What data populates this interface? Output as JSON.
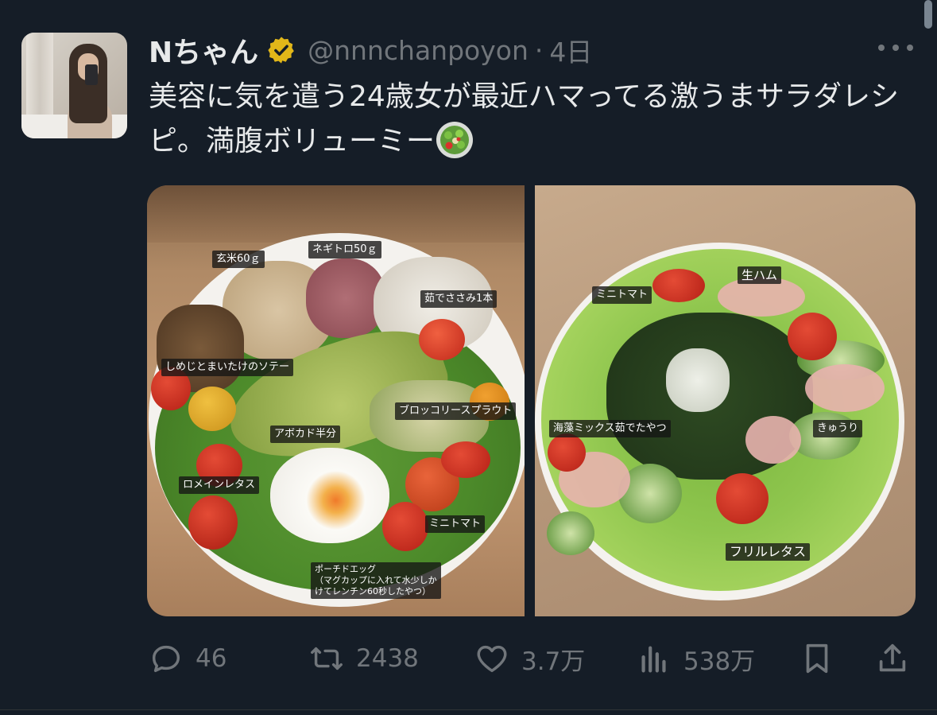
{
  "user": {
    "display_name": "Nちゃん",
    "handle": "@nnnchanpoyon",
    "separator": "·",
    "time": "4日",
    "verified": true
  },
  "tweet": {
    "text": "美容に気を遣う24歳女が最近ハマってる激うまサラダレシピ。満腹ボリューミー",
    "emoji": "salad-bowl-icon"
  },
  "media": {
    "left_labels": {
      "genmai": "玄米60ｇ",
      "negitoro": "ネギトロ50ｇ",
      "sasami": "茹でささみ1本",
      "shimeji": "しめじとまいたけのソテー",
      "broccoli": "ブロッコリースプラウト",
      "avocado": "アボカド半分",
      "romaine": "ロメインレタス",
      "minitomato": "ミニトマト",
      "poached": "ポーチドエッグ\n（マグカップに入れて水少しか\nけてレンチン60秒したやつ）"
    },
    "right_labels": {
      "minitomato": "ミニトマト",
      "namaham": "生ハム",
      "kaiso": "海藻ミックス茹でたやつ",
      "kyuri": "きゅうり",
      "frill": "フリルレタス"
    }
  },
  "actions": {
    "reply_count": "46",
    "retweet_count": "2438",
    "like_count": "3.7万",
    "views_count": "538万"
  },
  "colors": {
    "background": "#151d27",
    "text": "#e7e9ea",
    "muted": "#71767b",
    "verified_badge": "#e2b719"
  }
}
